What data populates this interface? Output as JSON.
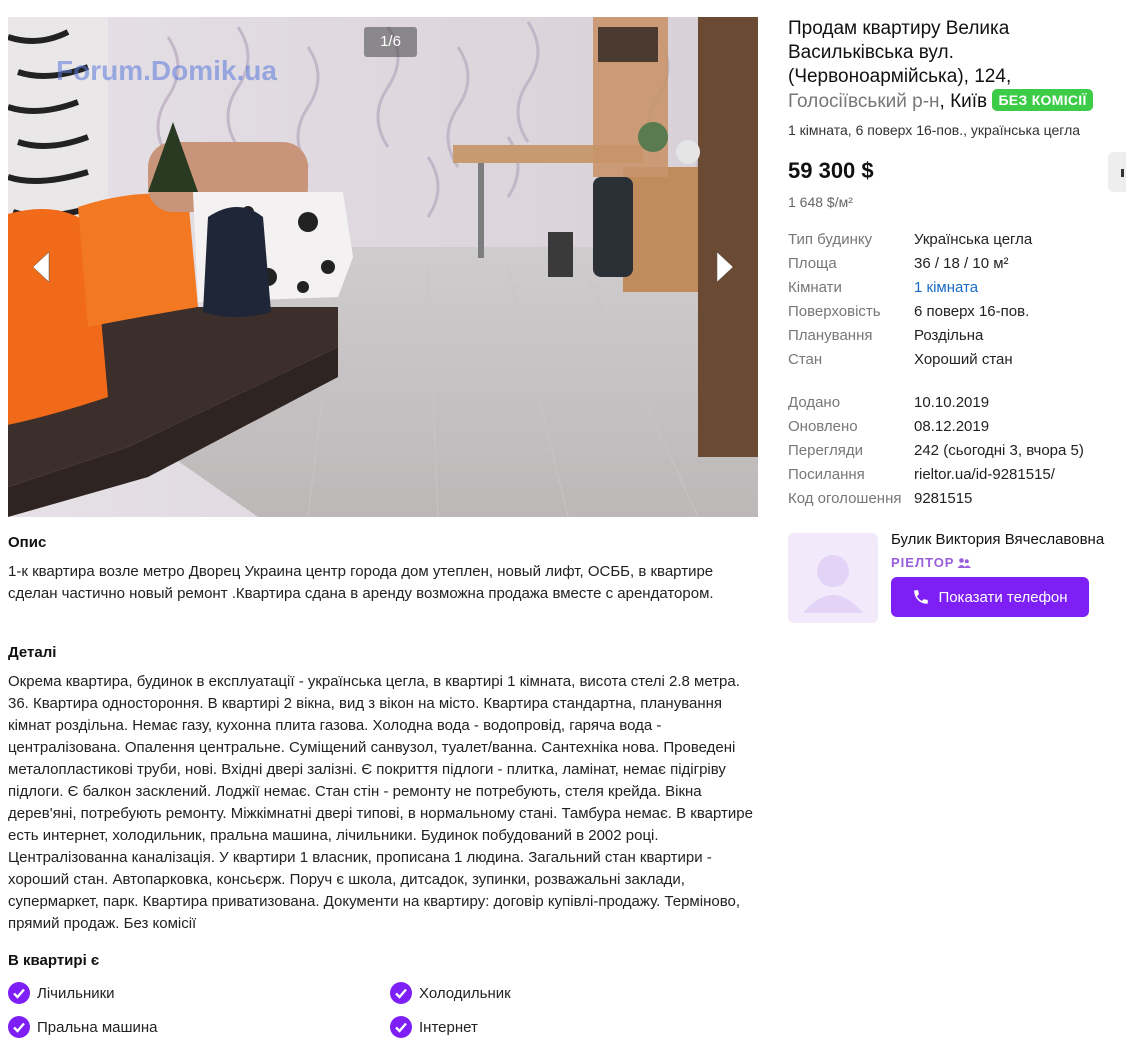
{
  "gallery": {
    "counter": "1/6",
    "watermark": "Forum.Domik.ua",
    "prev_icon": "chevron-left-icon",
    "next_icon": "chevron-right-icon"
  },
  "listing": {
    "title": "Продам квартиру Велика Васильківська вул. (Червоноармійська), 124,",
    "district": "Голосіївський р-н",
    "comma": ",",
    "city": "Київ",
    "badge": "БЕЗ КОМІСІЇ",
    "subtitle": "1 кімната, 6 поверх 16-пов., українська цегла",
    "price": "59 300  $",
    "price_per_m2": "1 648 $/м²"
  },
  "properties": [
    {
      "key": "Тип будинку",
      "value": "Українська цегла"
    },
    {
      "key": "Площа",
      "value": "36 / 18 / 10 м²"
    },
    {
      "key": "Кімнати",
      "value": "1 кімната"
    },
    {
      "key": "Поверховість",
      "value": "6 поверх 16-пов."
    },
    {
      "key": "Планування",
      "value": "Роздільна"
    },
    {
      "key": "Стан",
      "value": "Хороший стан"
    }
  ],
  "meta": [
    {
      "key": "Додано",
      "value": "10.10.2019"
    },
    {
      "key": "Оновлено",
      "value": "08.12.2019"
    },
    {
      "key": "Перегляди",
      "value": "242 (сьогодні 3, вчора 5)"
    },
    {
      "key": "Посилання",
      "value": "rieltor.ua/id-9281515/"
    },
    {
      "key": "Код оголошення",
      "value": "9281515"
    }
  ],
  "realtor": {
    "name": "Булик Виктория Вячеславовна",
    "role": "РІЕЛТОР",
    "phone_button": "Показати телефон"
  },
  "description": {
    "title": "Опис",
    "text": "1-к квартира возле метро Дворец Украина центр города дом утеплен, новый лифт, ОСББ, в квартире сделан частично новый ремонт .Квартира сдана в аренду возможна продажа вместе с арендатором."
  },
  "details": {
    "title": "Деталі",
    "text": "Окрема квартира, будинок в експлуатації - українська цегла, в квартирі 1 кімната, висота стелі 2.8 метра. 36. Квартира одностороння. В квартирі 2 вікна, вид з вікон на місто. Квартира стандартна, планування кімнат роздільна. Немає газу, кухонна плита газова. Холодна вода - водопровід, гаряча вода - централізована. Опалення центральне. Суміщений санвузол, туалет/ванна. Сантехніка нова. Проведені металопластикові труби, нові. Вхідні двері залізні. Є покриття підлоги - плитка, ламінат, немає підігріву підлоги. Є балкон засклений. Лоджії немає. Стан стін - ремонту не потребують, стеля крейда. Вікна дерев'яні, потребують ремонту. Міжкімнатні двері типові, в нормальному стані. Тамбура немає. В квартире есть интернет, холодильник, пральна машина, лічильники. Будинок побудований в 2002 році. Централізованна каналізація. У квартири 1 власник, прописана 1 людина. Загальний стан квартири - хороший стан. Автопарковка, консьєрж. Поруч є школа, дитсадок, зупинки, розважальні заклади, супермаркет, парк. Квартира приватизована. Документи на квартиру: договір купівлі-продажу. Терміново, прямий продаж. Без комісії"
  },
  "features": {
    "title": "В квартирі є",
    "items": [
      "Лічильники",
      "Холодильник",
      "Пральна машина",
      "Інтернет"
    ]
  },
  "colors": {
    "accent": "#7d1ff5",
    "badge": "#3dcc47",
    "link": "#1a6bc5"
  }
}
